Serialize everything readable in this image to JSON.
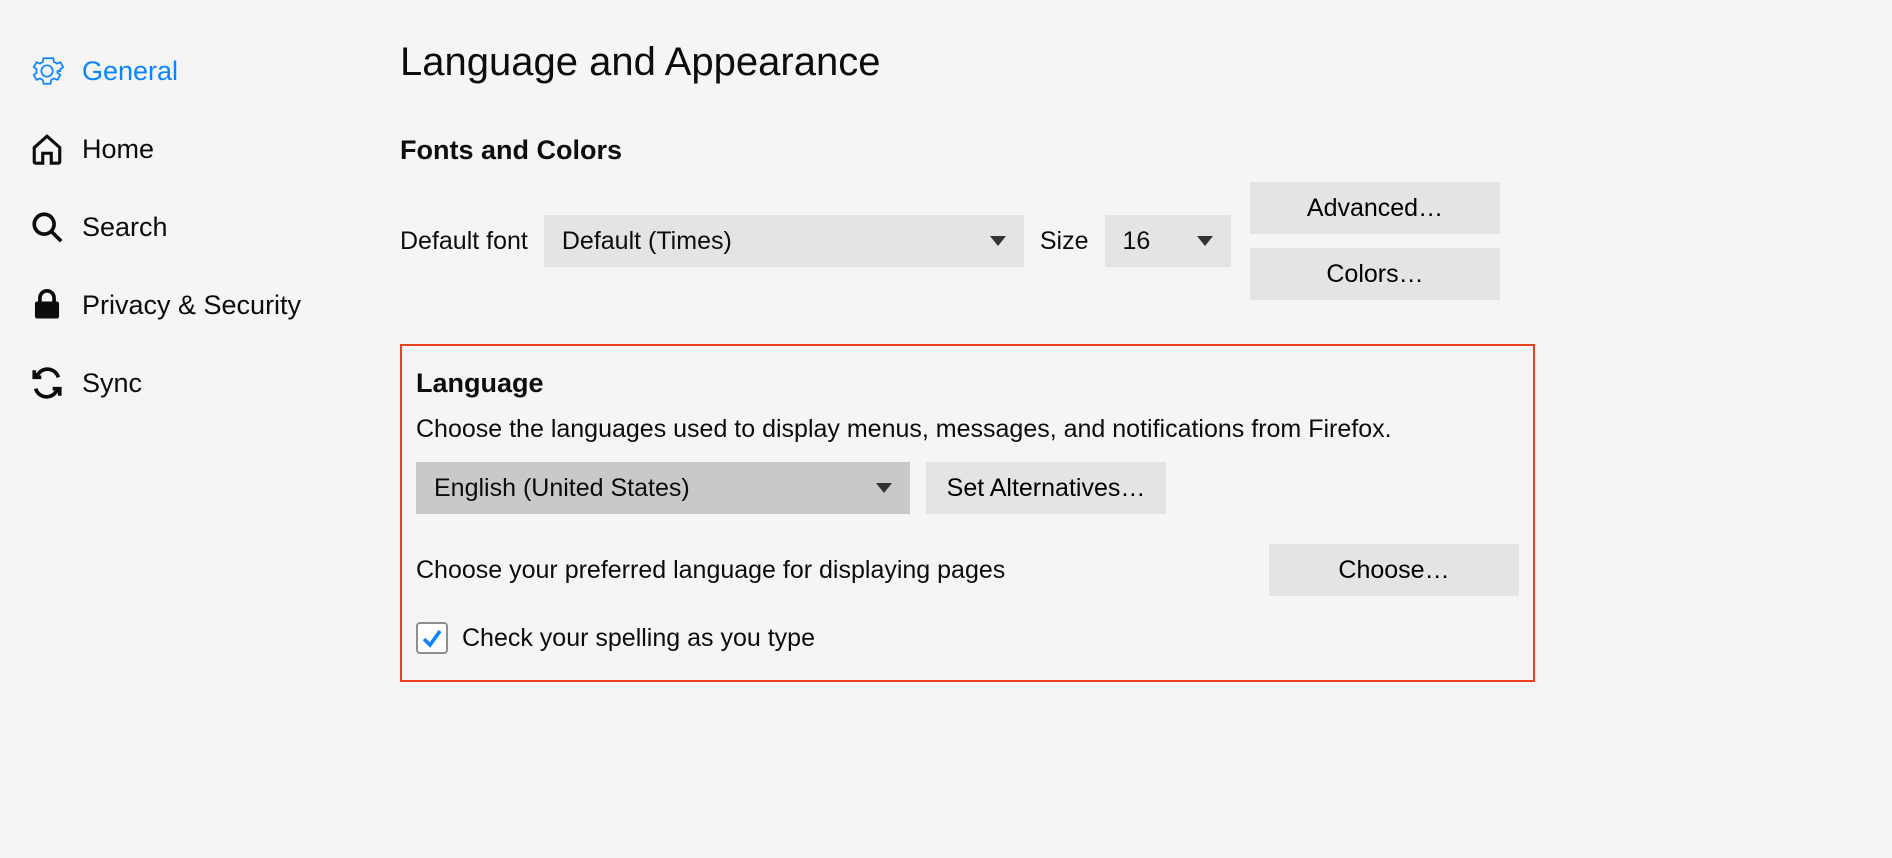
{
  "sidebar": {
    "items": [
      {
        "label": "General"
      },
      {
        "label": "Home"
      },
      {
        "label": "Search"
      },
      {
        "label": "Privacy & Security"
      },
      {
        "label": "Sync"
      }
    ]
  },
  "main": {
    "title": "Language and Appearance",
    "fonts": {
      "heading": "Fonts and Colors",
      "default_font_label": "Default font",
      "default_font_value": "Default (Times)",
      "size_label": "Size",
      "size_value": "16",
      "advanced_btn": "Advanced…",
      "colors_btn": "Colors…"
    },
    "language": {
      "heading": "Language",
      "desc": "Choose the languages used to display menus, messages, and notifications from Firefox.",
      "selected_language": "English (United States)",
      "set_alternatives_btn": "Set Alternatives…",
      "pages_desc": "Choose your preferred language for displaying pages",
      "choose_btn": "Choose…",
      "spellcheck_label": "Check your spelling as you type"
    }
  }
}
